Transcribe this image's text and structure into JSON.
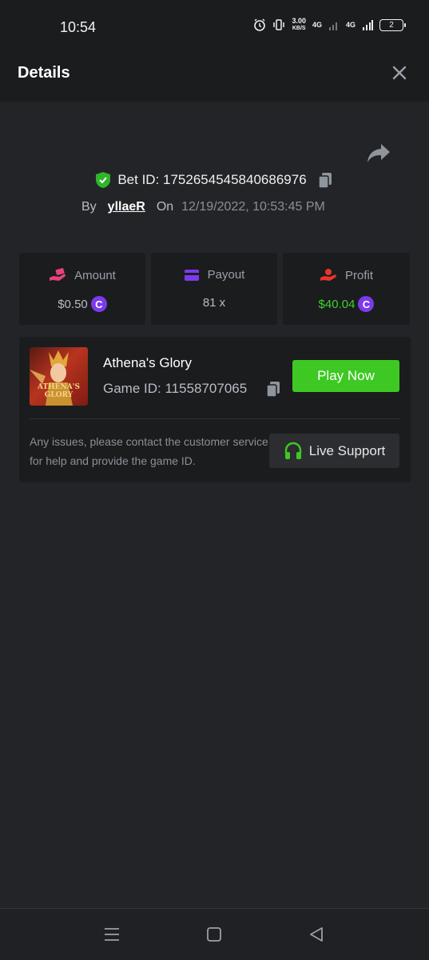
{
  "status_bar": {
    "time": "10:54",
    "net_speed_value": "3.00",
    "net_speed_unit": "KB/S",
    "network_1": "4G",
    "network_2": "4G",
    "battery": "2"
  },
  "header": {
    "title": "Details"
  },
  "bet": {
    "bet_id_label": "Bet ID: 1752654545840686976",
    "by_label": "By",
    "username": "yllaeR",
    "on_label": "On",
    "datetime": "12/19/2022, 10:53:45 PM"
  },
  "stats": [
    {
      "label": "Amount",
      "value": "$0.50",
      "icon": "money-hand-icon",
      "color": "#e6417a"
    },
    {
      "label": "Payout",
      "value": "81 x",
      "icon": "card-icon",
      "color": "#7c3aed"
    },
    {
      "label": "Profit",
      "value": "$40.04",
      "icon": "profit-hand-icon",
      "color": "#e8352a"
    }
  ],
  "coin_symbol": "C",
  "game": {
    "thumb_text": "ATHENA'S GLORY",
    "name": "Athena's Glory",
    "game_id": "Game ID: 11558707065",
    "play_label": "Play Now",
    "help_text": "Any issues, please contact the customer service for help and provide the game ID.",
    "support_label": "Live Support"
  },
  "colors": {
    "background": "#232427",
    "card": "#1b1c1e",
    "accent_green": "#3ec824",
    "coin_purple": "#7c3aed"
  }
}
